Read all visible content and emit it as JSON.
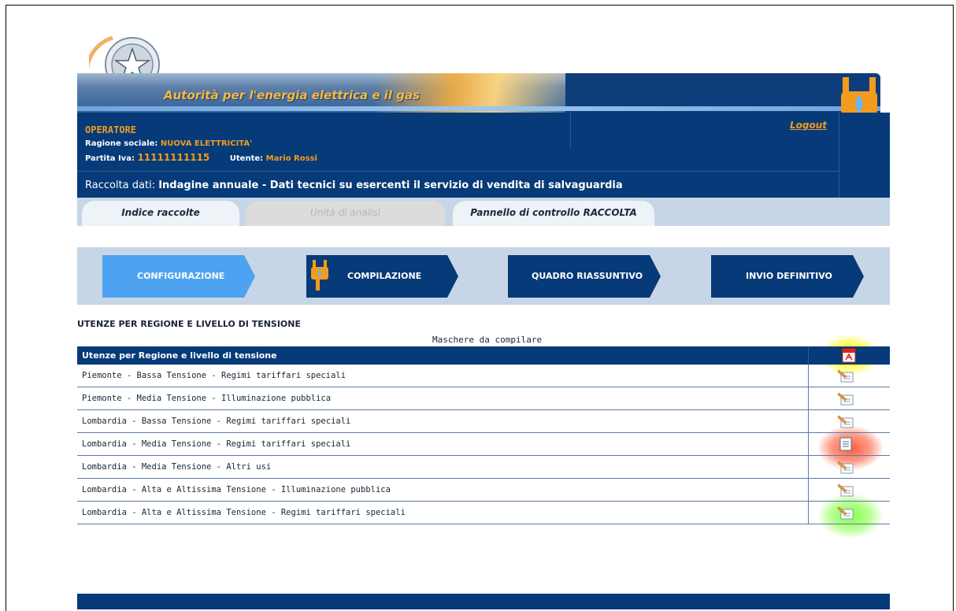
{
  "header": {
    "banner_title": "Autorità per l'energia elettrica e il gas",
    "operator_title": "OPERATORE",
    "ragione_label": "Ragione sociale:",
    "ragione_value": "NUOVA ELETTRICITA'",
    "piva_label": "Partita Iva:",
    "piva_value": "11111111115",
    "utente_label": "Utente:",
    "utente_value": "Mario Rossi",
    "logout": "Logout",
    "raccolta_label": "Raccolta dati:",
    "raccolta_value": "Indagine annuale - Dati tecnici su esercenti il servizio di vendita di salvaguardia"
  },
  "tabs": [
    {
      "label": "Indice raccolte"
    },
    {
      "label": "Unità di analisi"
    },
    {
      "label": "Pannello di controllo RACCOLTA"
    }
  ],
  "steps": [
    {
      "label": "CONFIGURAZIONE"
    },
    {
      "label": "COMPILAZIONE"
    },
    {
      "label": "QUADRO RIASSUNTIVO"
    },
    {
      "label": "INVIO DEFINITIVO"
    }
  ],
  "section": {
    "title": "UTENZE PER REGIONE E LIVELLO DI TENSIONE",
    "masks_label": "Maschere da compilare",
    "table_header": "Utenze per Regione e livello di tensione",
    "rows": [
      {
        "label": "Piemonte - Bassa Tensione - Regimi tariffari speciali",
        "icon": "edit-icon"
      },
      {
        "label": "Piemonte - Media Tensione - Illuminazione pubblica",
        "icon": "edit-icon"
      },
      {
        "label": "Lombardia - Bassa Tensione - Regimi tariffari speciali",
        "icon": "edit-icon"
      },
      {
        "label": "Lombardia - Media Tensione - Regimi tariffari speciali",
        "icon": "document-icon"
      },
      {
        "label": "Lombardia - Media Tensione - Altri usi",
        "icon": "edit-icon"
      },
      {
        "label": "Lombardia - Alta e Altissima Tensione - Illuminazione pubblica",
        "icon": "edit-icon"
      },
      {
        "label": "Lombardia - Alta e Altissima Tensione - Regimi tariffari speciali",
        "icon": "edit-icon"
      }
    ]
  },
  "colors": {
    "navy": "#063a78",
    "orange": "#f39b1e",
    "active_step": "#4da3f0",
    "panel_bg": "#c7d6e6"
  }
}
